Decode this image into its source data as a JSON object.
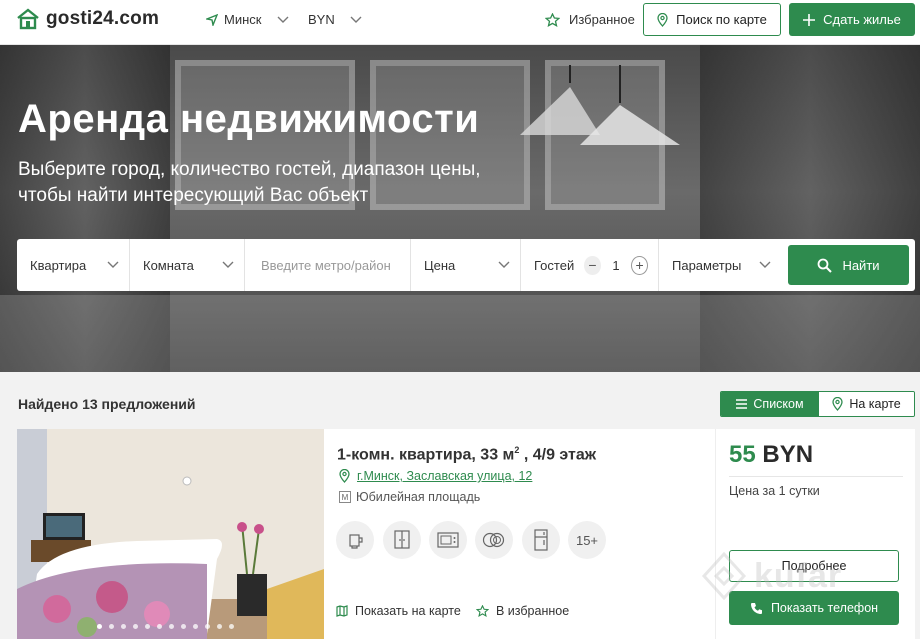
{
  "header": {
    "logo_text": "gosti24.com",
    "city": "Минск",
    "currency": "BYN",
    "favorites": "Избранное",
    "map_search": "Поиск по карте",
    "rent_out": "Сдать жилье"
  },
  "hero": {
    "title": "Аренда недвижимости",
    "subtitle": "Выберите город, количество гостей, диапазон цены, чтобы найти интересующий Вас объект"
  },
  "search": {
    "type": "Квартира",
    "rooms": "Комната",
    "metro_placeholder": "Введите метро/район",
    "price": "Цена",
    "guests_label": "Гостей",
    "guests_minus": "−",
    "guests_value": "1",
    "guests_plus": "+",
    "params": "Параметры",
    "find": "Найти"
  },
  "results": {
    "found": "Найдено 13 предложений",
    "view_list": "Списком",
    "view_map": "На карте"
  },
  "listing": {
    "title_main": "1-комн. квартира, 33 м",
    "title_sup": "2",
    "title_end": " , 4/9 этаж",
    "address": "г.Минск, Заславская улица, 12",
    "metro_badge": "М",
    "metro": "Юбилейная площадь",
    "amenities": [
      "kettle-icon",
      "wardrobe-icon",
      "microwave-icon",
      "dishes-icon",
      "fridge-icon"
    ],
    "amenities_more": "15+",
    "show_on_map": "Показать на карте",
    "add_favorite": "В избранное",
    "price_value": "55",
    "price_currency": "BYN",
    "price_period": "Цена за 1 сутки",
    "details": "Подробнее",
    "show_phone": "Показать телефон",
    "photo_count": 12,
    "photo_active": 1
  },
  "watermark": "kufar",
  "colors": {
    "accent": "#2e8b4e",
    "accent_light": "#5aa86f"
  }
}
